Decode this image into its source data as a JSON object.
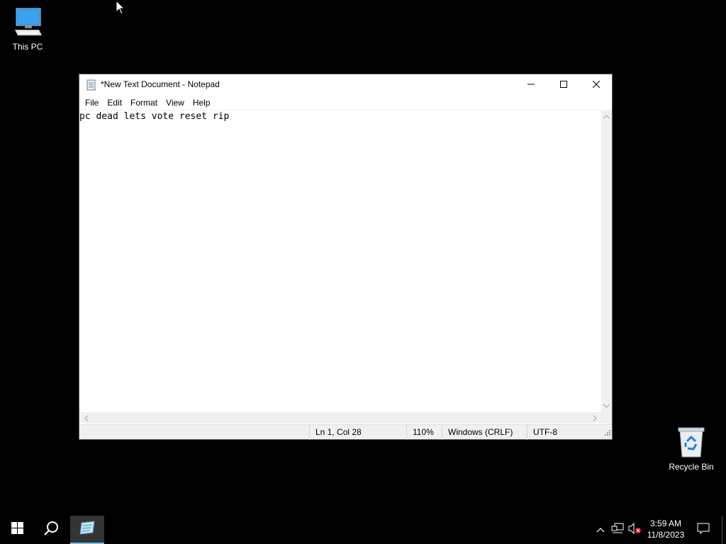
{
  "desktop": {
    "icons": [
      {
        "label": "This PC"
      },
      {
        "label": "Recycle Bin"
      }
    ]
  },
  "notepad": {
    "title": "*New Text Document - Notepad",
    "menu": [
      "File",
      "Edit",
      "Format",
      "View",
      "Help"
    ],
    "content": "pc dead lets vote reset rip",
    "status": {
      "position": "Ln 1, Col 28",
      "zoom": "110%",
      "line_ending": "Windows (CRLF)",
      "encoding": "UTF-8"
    }
  },
  "taskbar": {
    "clock_time": "3:59 AM",
    "clock_date": "11/8/2023",
    "accent_color": "#76b9ed"
  }
}
